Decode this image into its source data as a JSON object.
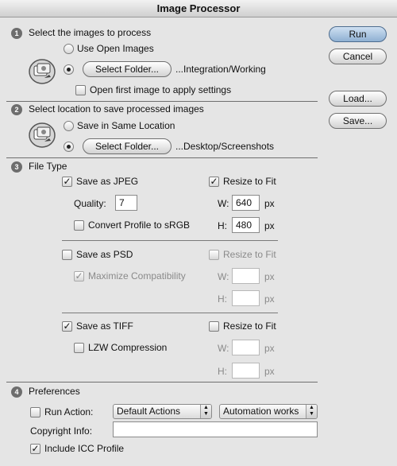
{
  "window": {
    "title": "Image Processor"
  },
  "sections": {
    "s1": {
      "num": "1",
      "title": "Select the images to process"
    },
    "s2": {
      "num": "2",
      "title": "Select location to save processed images"
    },
    "s3": {
      "num": "3",
      "title": "File Type"
    },
    "s4": {
      "num": "4",
      "title": "Preferences"
    }
  },
  "source": {
    "use_open_images": "Use Open Images",
    "select_folder": "Select Folder...",
    "folder_path": "...Integration/Working",
    "open_first_image": "Open first image to apply settings"
  },
  "destination": {
    "save_same_location": "Save in Same Location",
    "select_folder": "Select Folder...",
    "folder_path": "...Desktop/Screenshots"
  },
  "jpeg": {
    "save_as": "Save as JPEG",
    "quality_label": "Quality:",
    "quality_value": "7",
    "convert_profile": "Convert Profile to sRGB",
    "resize_to_fit": "Resize to Fit",
    "w_label": "W:",
    "w_value": "640",
    "h_label": "H:",
    "h_value": "480",
    "unit": "px"
  },
  "psd": {
    "save_as": "Save as PSD",
    "maximize_compat": "Maximize Compatibility",
    "resize_to_fit": "Resize to Fit",
    "w_label": "W:",
    "h_label": "H:",
    "unit": "px"
  },
  "tiff": {
    "save_as": "Save as TIFF",
    "lzw": "LZW Compression",
    "resize_to_fit": "Resize to Fit",
    "w_label": "W:",
    "h_label": "H:",
    "unit": "px"
  },
  "preferences": {
    "run_action": "Run Action:",
    "action_set": "Default Actions",
    "action": "Automation works",
    "copyright_label": "Copyright Info:",
    "copyright_value": "",
    "include_icc": "Include ICC Profile"
  },
  "buttons": {
    "run": "Run",
    "cancel": "Cancel",
    "load": "Load...",
    "save": "Save..."
  }
}
